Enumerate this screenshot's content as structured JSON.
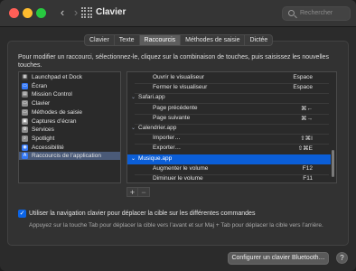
{
  "window": {
    "title": "Clavier",
    "search_placeholder": "Rechercher",
    "back_glyph": "‹",
    "forward_glyph": "›"
  },
  "tabs": [
    {
      "label": "Clavier",
      "active": false
    },
    {
      "label": "Texte",
      "active": false
    },
    {
      "label": "Raccourcis",
      "active": true
    },
    {
      "label": "Méthodes de saisie",
      "active": false
    },
    {
      "label": "Dictée",
      "active": false
    }
  ],
  "instructions": "Pour modifier un raccourci, sélectionnez-le, cliquez sur la combinaison de touches, puis saisissez les nouvelles touches.",
  "categories": [
    {
      "label": "Launchpad et Dock",
      "icon": "launchpad-icon",
      "color": "#3a3a3a",
      "glyph": "▦"
    },
    {
      "label": "Écran",
      "icon": "display-icon",
      "color": "#3478f6",
      "glyph": "▭"
    },
    {
      "label": "Mission Control",
      "icon": "mission-control-icon",
      "color": "#6f6f6f",
      "glyph": "▤"
    },
    {
      "label": "Clavier",
      "icon": "keyboard-icon",
      "color": "#8d8d8d",
      "glyph": "▭"
    },
    {
      "label": "Méthodes de saisie",
      "icon": "input-sources-icon",
      "color": "#8d8d8d",
      "glyph": "▭"
    },
    {
      "label": "Captures d’écran",
      "icon": "screenshot-icon",
      "color": "#8d8d8d",
      "glyph": "▣"
    },
    {
      "label": "Services",
      "icon": "services-icon",
      "color": "#8d8d8d",
      "glyph": "⚙"
    },
    {
      "label": "Spotlight",
      "icon": "spotlight-icon",
      "color": "#8d8d8d",
      "glyph": "⌕"
    },
    {
      "label": "Accessibilité",
      "icon": "accessibility-icon",
      "color": "#3478f6",
      "glyph": "◉"
    },
    {
      "label": "Raccourcis de l’application",
      "icon": "app-shortcuts-icon",
      "color": "#3478f6",
      "glyph": "A",
      "selected": true
    }
  ],
  "shortcuts": [
    {
      "label": "Ouvrir le visualiseur",
      "key": "Espace",
      "level": 2
    },
    {
      "label": "Fermer le visualiseur",
      "key": "Espace",
      "level": 2
    },
    {
      "label": "Safari.app",
      "key": "",
      "level": 1,
      "group": true
    },
    {
      "label": "Page précédente",
      "key": "⌘←",
      "level": 2
    },
    {
      "label": "Page suivante",
      "key": "⌘→",
      "level": 2
    },
    {
      "label": "Calendrier.app",
      "key": "",
      "level": 1,
      "group": true
    },
    {
      "label": "Importer…",
      "key": "⇧⌘I",
      "level": 2
    },
    {
      "label": "Exporter…",
      "key": "⇧⌘E",
      "level": 2
    },
    {
      "label": "Musique.app",
      "key": "",
      "level": 1,
      "group": true,
      "selected": true
    },
    {
      "label": "Augmenter le volume",
      "key": "F12",
      "level": 2
    },
    {
      "label": "Diminuer le volume",
      "key": "F11",
      "level": 2
    }
  ],
  "buttons": {
    "add": "+",
    "remove": "−",
    "bluetooth": "Configurer un clavier Bluetooth…",
    "help": "?"
  },
  "keyboard_nav": {
    "checked": true,
    "label": "Utiliser la navigation clavier pour déplacer la cible sur les différentes commandes",
    "note": "Appuyez sur la touche Tab pour déplacer la cible vers l’avant et sur Maj + Tab pour déplacer la cible vers l’arrière."
  },
  "colors": {
    "accent": "#0b5ed7",
    "close": "#ff5f57",
    "minimize": "#febc2e",
    "maximize": "#28c840"
  }
}
